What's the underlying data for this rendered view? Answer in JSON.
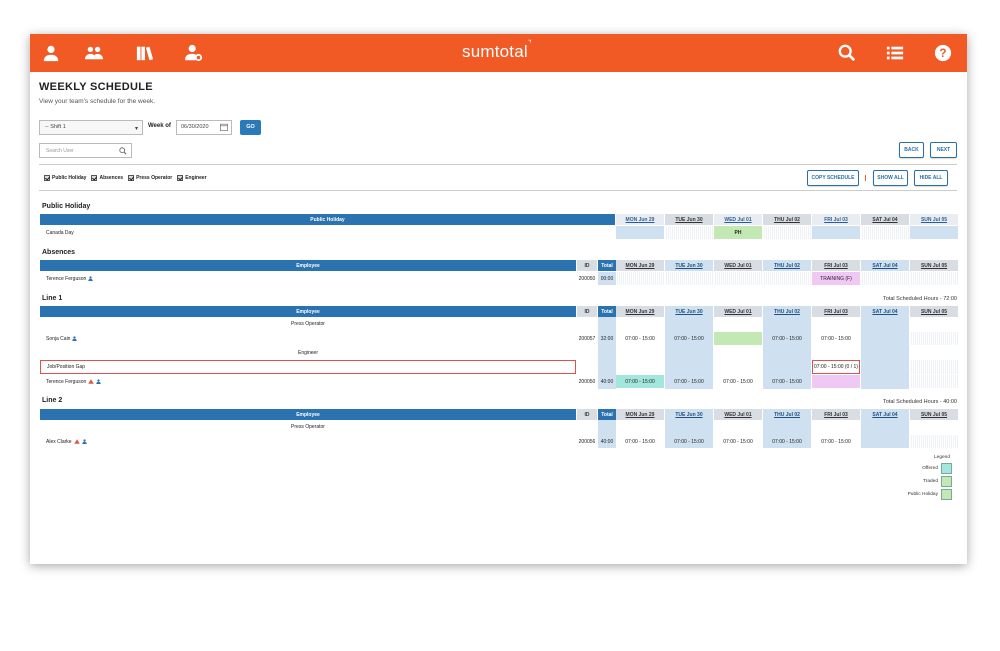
{
  "app": {
    "brand": "sumtotal",
    "nav_icons": [
      "user-icon",
      "team-icon",
      "library-icon",
      "user-settings-icon",
      "search-icon",
      "list-icon",
      "help-icon"
    ]
  },
  "page": {
    "title": "WEEKLY SCHEDULE",
    "subtitle": "View your team's schedule for the week."
  },
  "controls": {
    "shift_value": "-- Shift 1",
    "week_label": "Week of",
    "week_value": "06/30/2020",
    "go_label": "GO",
    "search_placeholder": "Search User",
    "back_label": "BACK",
    "next_label": "NEXT",
    "copy_label": "COPY SCHEDULE",
    "show_all_label": "SHOW ALL",
    "hide_all_label": "HIDE ALL"
  },
  "filters": [
    "Public Holiday",
    "Absences",
    "Press Operator",
    "Engineer"
  ],
  "days": [
    "MON Jun 29",
    "TUE Jun 30",
    "WED Jul 01",
    "THU Jul 02",
    "FRI Jul 03",
    "SAT Jul 04",
    "SUN Jul 05"
  ],
  "public_holiday": {
    "title": "Public Holiday",
    "header": "Public Holiday",
    "row_name": "Canada Day",
    "badge": "PH"
  },
  "absences": {
    "title": "Absences",
    "col_employee": "Employee",
    "col_id": "ID",
    "col_total": "Total",
    "row_name": "Terence Ferguson",
    "row_id": "200050",
    "row_total": "00:00",
    "fri": "TRAINING (F)"
  },
  "line1": {
    "title": "Line 1",
    "total_hours": "Total Scheduled Hours - 72:00",
    "col_employee": "Employee",
    "col_id": "ID",
    "col_total": "Total",
    "role1": "Press Operator",
    "sonja_name": "Sonja Cain",
    "sonja_id": "200057",
    "sonja_total": "32:00",
    "shift": "07:00 - 15:00",
    "role2": "Engineer",
    "gap_label": "Job/Position Gap",
    "gap_fri": "07:00 - 15:00 (0 / 1)",
    "terence_name": "Terence Ferguson",
    "terence_id": "200050",
    "terence_total": "40:00"
  },
  "line2": {
    "title": "Line 2",
    "total_hours": "Total Scheduled Hours - 40:00",
    "col_employee": "Employee",
    "col_id": "ID",
    "col_total": "Total",
    "role1": "Press Operator",
    "alex_name": "Alex Clarke",
    "alex_id": "200056",
    "alex_total": "40:00",
    "shift": "07:00 - 15:00"
  },
  "legend": {
    "title": "Legend",
    "items": [
      {
        "label": "Offered",
        "color": "#a3e6dc"
      },
      {
        "label": "Traded",
        "color": "#c4e8b4"
      },
      {
        "label": "Public Holiday",
        "color": "#c4e8b4"
      }
    ]
  }
}
